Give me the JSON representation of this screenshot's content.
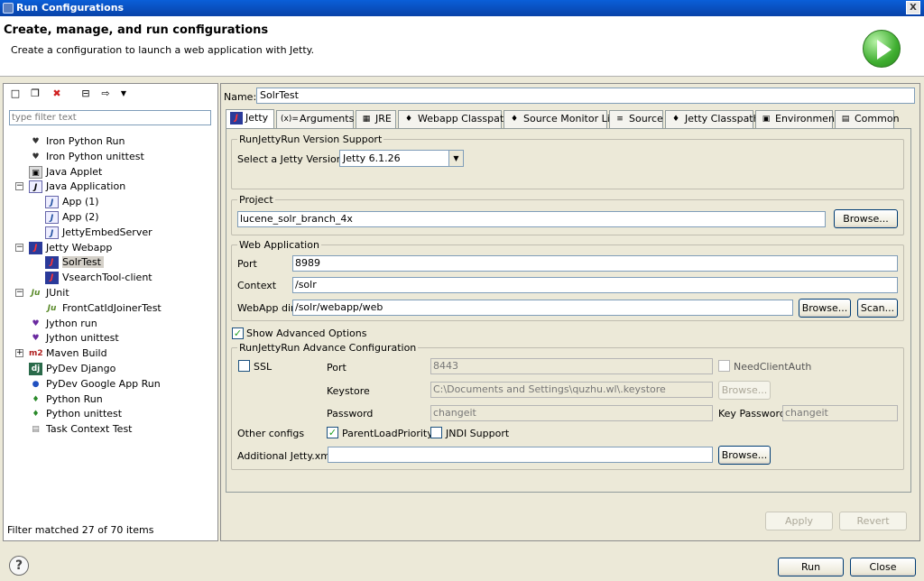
{
  "window": {
    "title": "Run Configurations",
    "close_glyph": "X"
  },
  "header": {
    "title": "Create, manage, and run configurations",
    "subtitle": "Create a configuration to launch a web application with Jetty."
  },
  "filter": {
    "placeholder": "type filter text",
    "status": "Filter matched 27 of 70 items"
  },
  "tree": [
    {
      "label": "Iron Python Run",
      "icon": "iron-python-icon",
      "level": 0
    },
    {
      "label": "Iron Python unittest",
      "icon": "iron-python-unittest-icon",
      "level": 0
    },
    {
      "label": "Java Applet",
      "icon": "java-applet-icon",
      "level": 0
    },
    {
      "label": "Java Application",
      "icon": "java-application-icon",
      "level": 0,
      "expanded": true
    },
    {
      "label": "App (1)",
      "icon": "java-file-icon",
      "level": 1
    },
    {
      "label": "App (2)",
      "icon": "java-file-icon",
      "level": 1
    },
    {
      "label": "JettyEmbedServer",
      "icon": "java-file-icon",
      "level": 1
    },
    {
      "label": "Jetty Webapp",
      "icon": "jetty-icon",
      "level": 0,
      "expanded": true
    },
    {
      "label": "SolrTest",
      "icon": "jetty-icon",
      "level": 1,
      "selected": true
    },
    {
      "label": "VsearchTool-client",
      "icon": "jetty-icon",
      "level": 1
    },
    {
      "label": "JUnit",
      "icon": "junit-icon",
      "level": 0,
      "expanded": true
    },
    {
      "label": "FrontCatIdJoinerTest",
      "icon": "junit-icon",
      "level": 1
    },
    {
      "label": "Jython run",
      "icon": "jython-icon",
      "level": 0
    },
    {
      "label": "Jython unittest",
      "icon": "jython-unittest-icon",
      "level": 0
    },
    {
      "label": "Maven Build",
      "icon": "maven-icon",
      "level": 0,
      "collapsed": true
    },
    {
      "label": "PyDev Django",
      "icon": "django-icon",
      "level": 0
    },
    {
      "label": "PyDev Google App Run",
      "icon": "google-app-icon",
      "level": 0
    },
    {
      "label": "Python Run",
      "icon": "python-icon",
      "level": 0
    },
    {
      "label": "Python unittest",
      "icon": "python-unittest-icon",
      "level": 0
    },
    {
      "label": "Task Context Test",
      "icon": "task-context-icon",
      "level": 0
    }
  ],
  "icon_glyphs": {
    "jetty": "J",
    "junit": "Ju",
    "maven": "m2",
    "django": "dj",
    "java": "J"
  },
  "name": {
    "label": "Name:",
    "value": "SolrTest"
  },
  "tabs": [
    "Jetty",
    "Arguments",
    "JRE",
    "Webapp Classpath",
    "Source Monitor List",
    "Source",
    "Jetty Classpath",
    "Environment",
    "Common"
  ],
  "tab_glyphs": {
    "arguments": "(x)="
  },
  "version": {
    "legend": "RunJettyRun Version Support",
    "label": "Select a Jetty Version:",
    "value": "Jetty 6.1.26"
  },
  "project": {
    "legend": "Project",
    "value": "lucene_solr_branch_4x",
    "browse": "Browse..."
  },
  "webapp": {
    "legend": "Web Application",
    "port_label": "Port",
    "port": "8989",
    "context_label": "Context",
    "context": "/solr",
    "dir_label": "WebApp dir",
    "dir": "/solr/webapp/web",
    "browse": "Browse...",
    "scan": "Scan..."
  },
  "advanced": {
    "show_label": "Show Advanced Options",
    "legend": "RunJettyRun Advance Configuration",
    "ssl": "SSL",
    "port_label": "Port",
    "port": "8443",
    "need_client_auth": "NeedClientAuth",
    "keystore_label": "Keystore",
    "keystore": "C:\\Documents and Settings\\quzhu.wl\\.keystore",
    "keystore_browse": "Browse...",
    "password_label": "Password",
    "password": "changeit",
    "key_password_label": "Key Password",
    "key_password": "changeit",
    "other_label": "Other configs",
    "parent_load": "ParentLoadPriority",
    "jndi": "JNDI Support",
    "additional_label": "Additional Jetty.xml",
    "additional_value": "",
    "additional_browse": "Browse..."
  },
  "buttons": {
    "apply": "Apply",
    "revert": "Revert",
    "run": "Run",
    "close": "Close"
  },
  "help": "?"
}
